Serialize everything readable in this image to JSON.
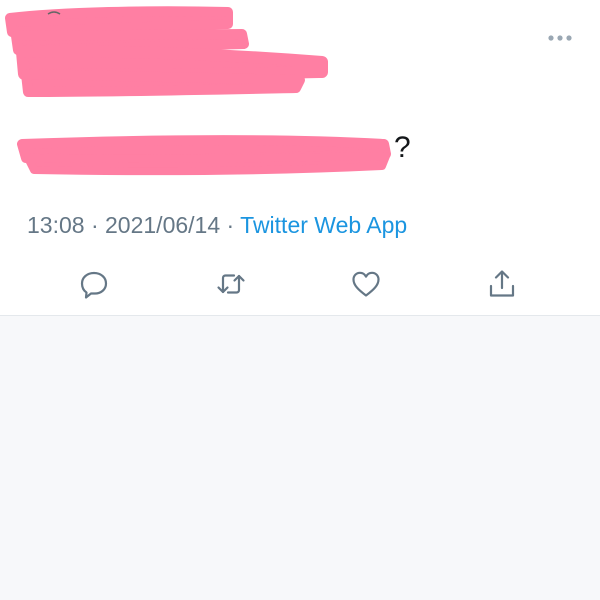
{
  "tweet": {
    "text_visible_tail": "?",
    "timestamp": {
      "time": "13:08",
      "separator1": " · ",
      "date": "2021/06/14",
      "separator2": " · ",
      "source": "Twitter Web App"
    }
  },
  "icons": {
    "more": "more-horizontal-icon",
    "reply": "reply-icon",
    "retweet": "retweet-icon",
    "like": "heart-icon",
    "share": "share-icon"
  },
  "colors": {
    "redaction": "#ff7fa3",
    "source_link": "#1b95e0",
    "meta_text": "#657786",
    "icon": "#657786"
  }
}
